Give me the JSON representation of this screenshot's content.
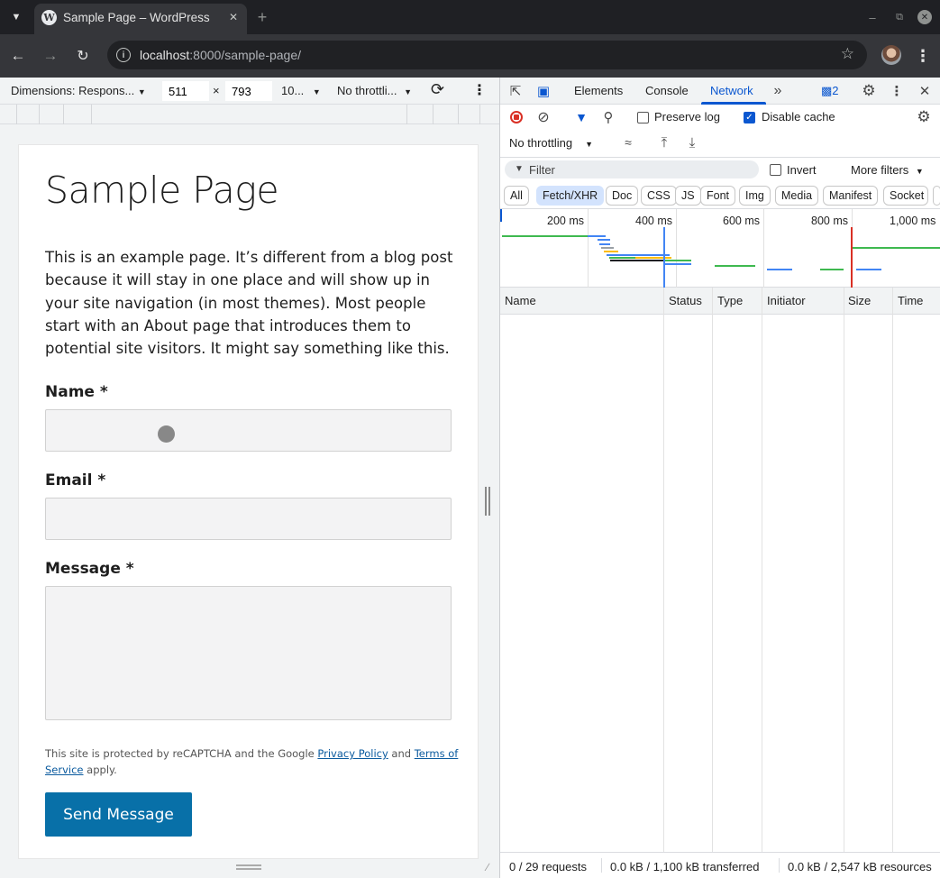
{
  "browser": {
    "tab_title": "Sample Page – WordPress",
    "url_host": "localhost",
    "url_path": ":8000/sample-page/"
  },
  "device_toolbar": {
    "dimensions_label": "Dimensions: Respons...",
    "width_value": "511",
    "times": "×",
    "height_value": "793",
    "zoom_label": "10...",
    "throttle_label": "No throttli..."
  },
  "page": {
    "title": "Sample Page",
    "paragraph": "This is an example page. It’s different from a blog post because it will stay in one place and will show up in your site navigation (in most themes). Most people start with an About page that introduces them to potential site visitors. It might say something like this.",
    "name_label": "Name *",
    "email_label": "Email *",
    "message_label": "Message *",
    "recaptcha_prefix": "This site is protected by reCAPTCHA and the Google ",
    "privacy_link": "Privacy Policy",
    "recaptcha_and": " and ",
    "terms_link": "Terms of Service",
    "recaptcha_suffix": " apply.",
    "send_button": "Send Message"
  },
  "devtools": {
    "tabs": [
      "Elements",
      "Console",
      "Network"
    ],
    "active_tab": "Network",
    "issues_count": "2",
    "preserve_log": "Preserve log",
    "disable_cache": "Disable cache",
    "throttling": "No throttling",
    "filter_placeholder": "Filter",
    "invert": "Invert",
    "more_filters": "More filters",
    "type_filters": [
      "All",
      "Fetch/XHR",
      "Doc",
      "CSS",
      "JS",
      "Font",
      "Img",
      "Media",
      "Manifest",
      "Socket"
    ],
    "active_type_filter": "Fetch/XHR",
    "timeline_labels": [
      "200 ms",
      "400 ms",
      "600 ms",
      "800 ms",
      "1,000 ms"
    ],
    "columns": [
      "Name",
      "Status",
      "Type",
      "Initiator",
      "Size",
      "Time"
    ],
    "status_requests": "0 / 29 requests",
    "status_transferred": "0.0 kB / 1,100 kB transferred",
    "status_resources": "0.0 kB / 2,547 kB resources"
  },
  "colors": {
    "accent_blue": "#0b57d0",
    "send_button_bg": "#0870a8",
    "record_red": "#d93025"
  }
}
